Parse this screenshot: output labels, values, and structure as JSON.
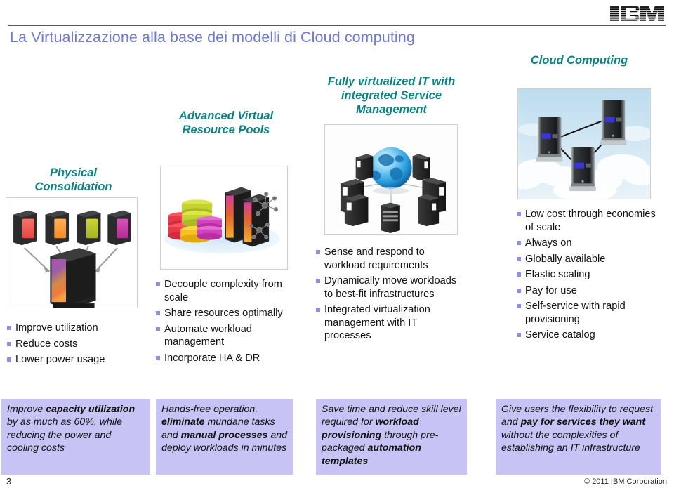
{
  "logo": {
    "alt": "IBM"
  },
  "title": "La Virtualizzazione alla base dei modelli di Cloud computing",
  "columns": [
    {
      "heading": "Physical\nConsolidation",
      "image_name": "physical-consolidation-image",
      "bullets": [
        "Improve utilization",
        "Reduce costs",
        "Lower power usage"
      ],
      "note_plain": "Improve capacity utilization by as much as 60%, while reducing the power and cooling costs",
      "note_parts": [
        {
          "text": "Improve ",
          "bold": false
        },
        {
          "text": "capacity utilization",
          "bold": true
        },
        {
          "text": " by as much as 60%, while reducing the power and cooling costs",
          "bold": false
        }
      ]
    },
    {
      "heading": "Advanced Virtual\nResource Pools",
      "image_name": "virtual-resource-pools-image",
      "bullets": [
        "Decouple complexity from scale",
        "Share resources optimally",
        "Automate workload management",
        "Incorporate HA & DR"
      ],
      "note_plain": "Hands-free operation, eliminate mundane tasks and manual processes and deploy workloads in minutes",
      "note_parts": [
        {
          "text": "Hands-free operation, ",
          "bold": false
        },
        {
          "text": "eliminate",
          "bold": true
        },
        {
          "text": " mundane tasks and ",
          "bold": false
        },
        {
          "text": "manual processes",
          "bold": true
        },
        {
          "text": " and deploy workloads in minutes",
          "bold": false
        }
      ]
    },
    {
      "heading": "Fully virtualized IT with\nintegrated Service\nManagement",
      "image_name": "integrated-service-management-image",
      "bullets": [
        "Sense and respond to workload requirements",
        "Dynamically move workloads to best-fit infrastructures",
        "Integrated virtualization management with IT processes"
      ],
      "note_plain": "Save time and reduce skill level required for workload provisioning through pre-packaged automation templates",
      "note_parts": [
        {
          "text": "Save time and reduce skill level required for ",
          "bold": false
        },
        {
          "text": "workload provisioning",
          "bold": true
        },
        {
          "text": " through pre-packaged ",
          "bold": false
        },
        {
          "text": "automation templates",
          "bold": true
        }
      ]
    },
    {
      "heading": "Cloud Computing",
      "image_name": "cloud-computing-image",
      "bullets": [
        "Low cost through economies of scale",
        "Always on",
        "Globally available",
        "Elastic scaling",
        "Pay for use",
        "Self-service with rapid provisioning",
        "Service catalog"
      ],
      "note_plain": "Give users the flexibility to request and pay for services they want without the complexities of establishing an IT infrastructure",
      "note_parts": [
        {
          "text": "Give users the flexibility to request and ",
          "bold": false
        },
        {
          "text": "pay for services they want",
          "bold": true
        },
        {
          "text": " without the complexities of establishing an IT infrastructure",
          "bold": false
        }
      ]
    }
  ],
  "footer": {
    "slide_number": "3",
    "copyright": "© 2011 IBM Corporation"
  },
  "colors": {
    "title": "#6f78d6",
    "heading_teal": "#0d8080",
    "bullet_square": "#8a92de",
    "note_background": "#c7c3f5",
    "rule": "#5a5a5a"
  }
}
